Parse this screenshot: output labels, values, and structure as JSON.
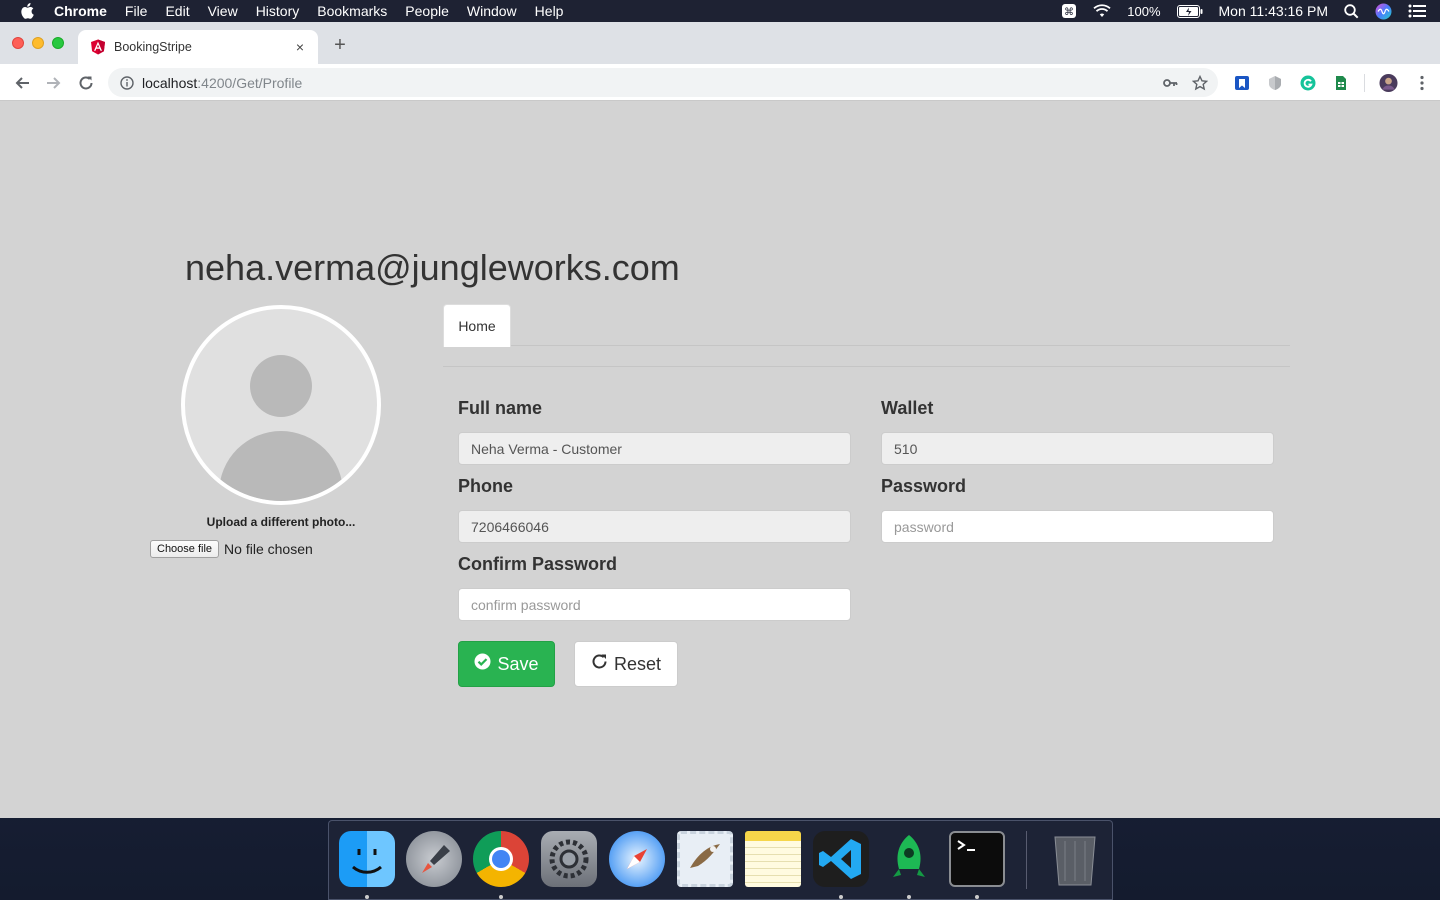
{
  "menubar": {
    "app_name": "Chrome",
    "items": [
      "File",
      "Edit",
      "View",
      "History",
      "Bookmarks",
      "People",
      "Window",
      "Help"
    ],
    "battery": "100%",
    "clock": "Mon 11:43:16 PM"
  },
  "browser": {
    "tab_title": "BookingStripe",
    "tab_close": "×",
    "new_tab": "+",
    "url_host": "localhost",
    "url_path": ":4200/Get/Profile"
  },
  "profile": {
    "email": "neha.verma@jungleworks.com",
    "upload_label": "Upload a different photo...",
    "choose_file_label": "Choose file",
    "file_status": "No file chosen"
  },
  "tabs": {
    "home_label": "Home"
  },
  "form": {
    "full_name_label": "Full name",
    "full_name_value": "Neha Verma - Customer",
    "wallet_label": "Wallet",
    "wallet_value": "510",
    "phone_label": "Phone",
    "phone_value": "7206466046",
    "password_label": "Password",
    "password_placeholder": "password",
    "confirm_label": "Confirm Password",
    "confirm_placeholder": "confirm password",
    "save_label": "Save",
    "reset_label": "Reset"
  },
  "dock": {
    "apps": [
      "finder-icon",
      "launchpad-icon",
      "chrome-icon",
      "system-preferences-icon",
      "safari-icon",
      "mail-icon",
      "notes-icon",
      "vscode-icon",
      "rocket-app-icon",
      "terminal-icon",
      "trash-icon"
    ]
  },
  "colors": {
    "save_green": "#29b351",
    "page_bg": "#d3d3d3",
    "input_readonly_bg": "#eeeeee"
  }
}
